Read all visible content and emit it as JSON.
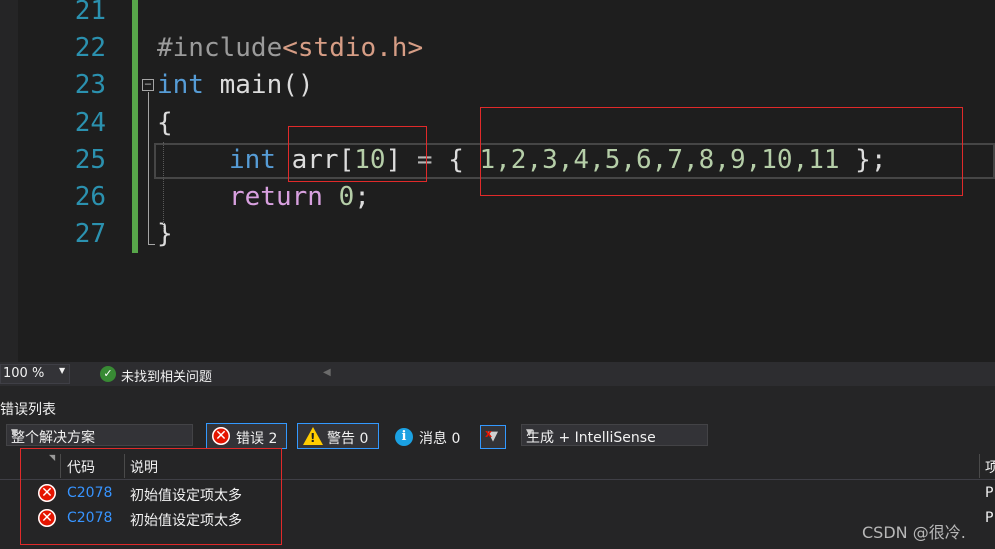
{
  "editor": {
    "lines": [
      {
        "number": "21"
      },
      {
        "number": "22",
        "tokens": {
          "directive": "#include",
          "header": "<stdio.h>"
        }
      },
      {
        "number": "23",
        "tokens": {
          "kw": "int",
          "rest": " main()"
        }
      },
      {
        "number": "24",
        "tokens": {
          "brace": "{"
        }
      },
      {
        "number": "25",
        "tokens": {
          "kw": "int",
          "ident": " arr[",
          "size": "10",
          "close": "]",
          "assign": " = ",
          "open_brace": "{ ",
          "values": "1,2,3,4,5,6,7,8,9,10,11",
          "end": " };"
        }
      },
      {
        "number": "26",
        "tokens": {
          "kw": "return",
          "space": " ",
          "num": "0",
          "semi": ";"
        }
      },
      {
        "number": "27",
        "tokens": {
          "brace": "}"
        }
      }
    ],
    "fold_glyph": "−"
  },
  "status": {
    "zoom": "100 %",
    "issues": "未找到相关问题"
  },
  "error_list": {
    "title": "错误列表",
    "scope": "整个解决方案",
    "errors_filter": "错误 2",
    "warnings_filter": "警告 0",
    "messages_filter": "消息 0",
    "build_source": "生成 + IntelliSense",
    "columns": {
      "code": "代码",
      "description": "说明",
      "project": "项"
    },
    "rows": [
      {
        "code": "C2078",
        "description": "初始值设定项太多",
        "project": "P"
      },
      {
        "code": "C2078",
        "description": "初始值设定项太多",
        "project": "P"
      }
    ]
  },
  "watermark": "CSDN @很冷."
}
